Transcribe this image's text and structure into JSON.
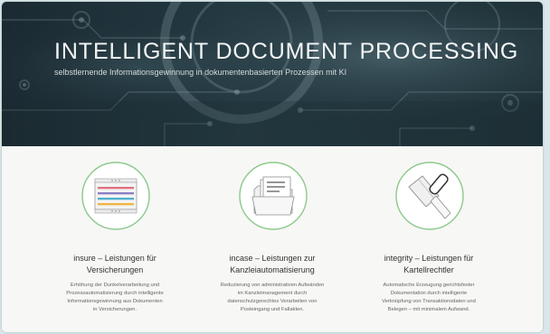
{
  "hero": {
    "title": "INTELLIGENT DOCUMENT PROCESSING",
    "subtitle": "selbstlernende Informationsgewinnung in dokumentenbasierten Prozessen mit KI"
  },
  "services": [
    {
      "icon": "document-list-icon",
      "title_line1": "insure – Leistungen für",
      "title_line2": "Versicherungen",
      "desc_line1": "Erhöhung der Dunkelverarbeitung und",
      "desc_line2": "Prozessautomatisierung durch intelligente",
      "desc_line3": "Informationsgewinnung aus Dokumenten",
      "desc_line4": "in Versicherungen."
    },
    {
      "icon": "folder-documents-icon",
      "title_line1": "incase – Leistungen zur",
      "title_line2": "Kanzleiautomatisierung",
      "desc_line1": "Reduzierung von administrativen Aufwänden",
      "desc_line2": "im Kanzleimanagement durch",
      "desc_line3": "datenschutzgerechtes Verarbeiten von",
      "desc_line4": "Posteingang und Fallakten."
    },
    {
      "icon": "gavel-icon",
      "title_line1": "integrity – Leistungen für",
      "title_line2": "Kartellrechtler",
      "desc_line1": "Automatische Erzeugung gerichtsfester",
      "desc_line2": "Dokumentation durch intelligente",
      "desc_line3": "Verknüpfung von Transaktionsdaten und",
      "desc_line4": "Belegen – mit minimalem Aufwand."
    }
  ],
  "colors": {
    "accent_green": "#8cc98a",
    "hero_dark": "#1f3038"
  }
}
